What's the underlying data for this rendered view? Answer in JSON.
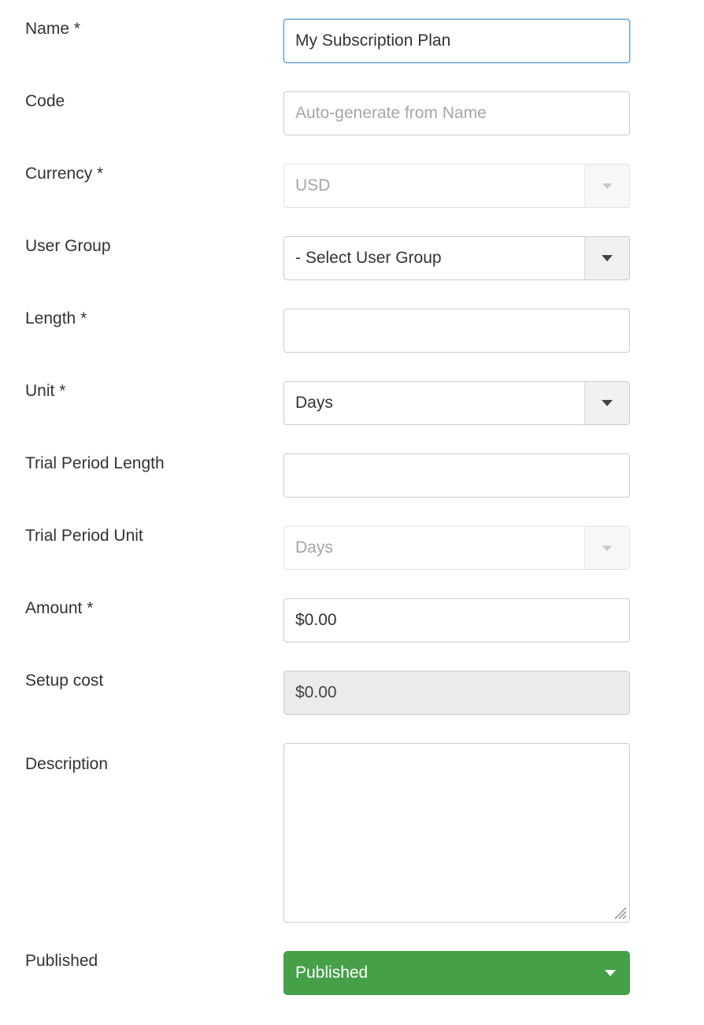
{
  "form": {
    "fields": [
      {
        "id": "name",
        "label": "Name",
        "required_mark": "*",
        "type": "text",
        "value": "My Subscription Plan",
        "placeholder": "",
        "state": "focused"
      },
      {
        "id": "code",
        "label": "Code",
        "required_mark": "",
        "type": "text",
        "value": "",
        "placeholder": "Auto-generate from Name",
        "state": "normal"
      },
      {
        "id": "currency",
        "label": "Currency",
        "required_mark": "*",
        "type": "select",
        "value": "USD",
        "state": "disabled"
      },
      {
        "id": "user-group",
        "label": "User Group",
        "required_mark": "",
        "type": "select",
        "value": "- Select User Group",
        "state": "normal"
      },
      {
        "id": "length",
        "label": "Length",
        "required_mark": "*",
        "type": "text",
        "value": "",
        "placeholder": "",
        "state": "normal"
      },
      {
        "id": "unit",
        "label": "Unit",
        "required_mark": "*",
        "type": "select",
        "value": "Days",
        "state": "normal"
      },
      {
        "id": "trial-period-length",
        "label": "Trial Period Length",
        "required_mark": "",
        "type": "text",
        "value": "",
        "placeholder": "",
        "state": "normal"
      },
      {
        "id": "trial-period-unit",
        "label": "Trial Period Unit",
        "required_mark": "",
        "type": "select",
        "value": "Days",
        "state": "disabled"
      },
      {
        "id": "amount",
        "label": "Amount",
        "required_mark": "*",
        "type": "text",
        "value": "$0.00",
        "placeholder": "",
        "state": "normal"
      },
      {
        "id": "setup-cost",
        "label": "Setup cost",
        "required_mark": "",
        "type": "text",
        "value": "$0.00",
        "placeholder": "",
        "state": "readonly"
      },
      {
        "id": "description",
        "label": "Description",
        "required_mark": "",
        "type": "textarea",
        "value": "",
        "placeholder": "",
        "state": "normal"
      },
      {
        "id": "published",
        "label": "Published",
        "required_mark": "",
        "type": "select",
        "value": "Published",
        "state": "published"
      }
    ],
    "icons": {
      "dropdown_caret": "chevron-down-icon",
      "resize_grip": "resize-handle-icon"
    },
    "colors": {
      "published_green": "#45a048",
      "focus_blue": "#5b9dd9",
      "border_grey": "#cccccc",
      "readonly_fill": "#ebebeb",
      "placeholder_grey": "#a6a6a6",
      "text": "#333333"
    }
  }
}
